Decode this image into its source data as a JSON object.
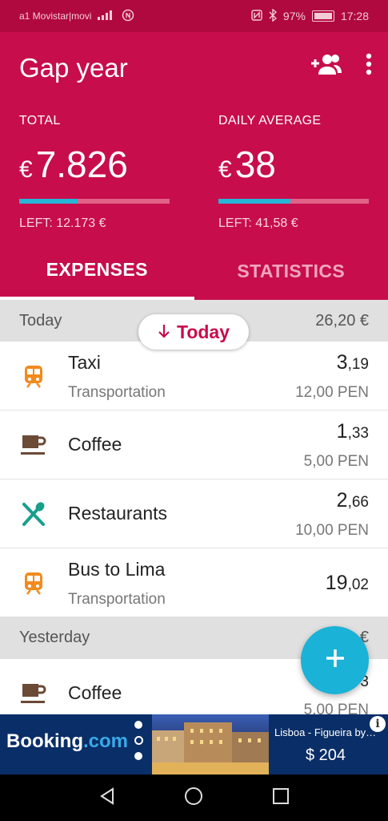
{
  "status": {
    "carrier": "a1 Movistar|movi",
    "battery": "97%",
    "time": "17:28"
  },
  "header": {
    "title": "Gap year",
    "total": {
      "label": "TOTAL",
      "currency": "€",
      "value": "7.826",
      "left": "LEFT: 12.173 €",
      "progress": 0.39
    },
    "daily": {
      "label": "DAILY AVERAGE",
      "currency": "€",
      "value": "38",
      "left": "LEFT: 41,58 €",
      "progress": 0.48
    }
  },
  "tabs": [
    "EXPENSES",
    "STATISTICS"
  ],
  "today_chip": "Today",
  "sections": [
    {
      "title": "Today",
      "total": "26,20 €",
      "items": [
        {
          "icon": "train-icon",
          "name": "Taxi",
          "category": "Transportation",
          "amount_main": "3",
          "amount_dec": ",19",
          "original": "12,00 PEN"
        },
        {
          "icon": "coffee-cup-icon",
          "name": "Coffee",
          "category": "",
          "amount_main": "1",
          "amount_dec": ",33",
          "original": "5,00 PEN"
        },
        {
          "icon": "fork-knife-icon",
          "name": "Restaurants",
          "category": "",
          "amount_main": "2",
          "amount_dec": ",66",
          "original": "10,00 PEN"
        },
        {
          "icon": "train-icon",
          "name": "Bus to Lima",
          "category": "Transportation",
          "amount_main": "19",
          "amount_dec": ",02",
          "original": ""
        }
      ]
    },
    {
      "title": "Yesterday",
      "total": "€",
      "items": [
        {
          "icon": "coffee-cup-icon",
          "name": "Coffee",
          "category": "",
          "amount_main": "",
          "amount_dec": "3",
          "original": "5,00 PEN"
        }
      ]
    }
  ],
  "ad": {
    "brand_a": "Booking",
    "brand_b": ".com",
    "destination": "Lisboa - Figueira by…",
    "price": "$ 204",
    "info": "i"
  },
  "colors": {
    "primary": "#c70d4c",
    "statusbar": "#b0093f",
    "accent": "#1ab2d6",
    "transport": "#f28a1e",
    "coffee": "#6b4a36",
    "restaurant": "#1a9e8c"
  }
}
